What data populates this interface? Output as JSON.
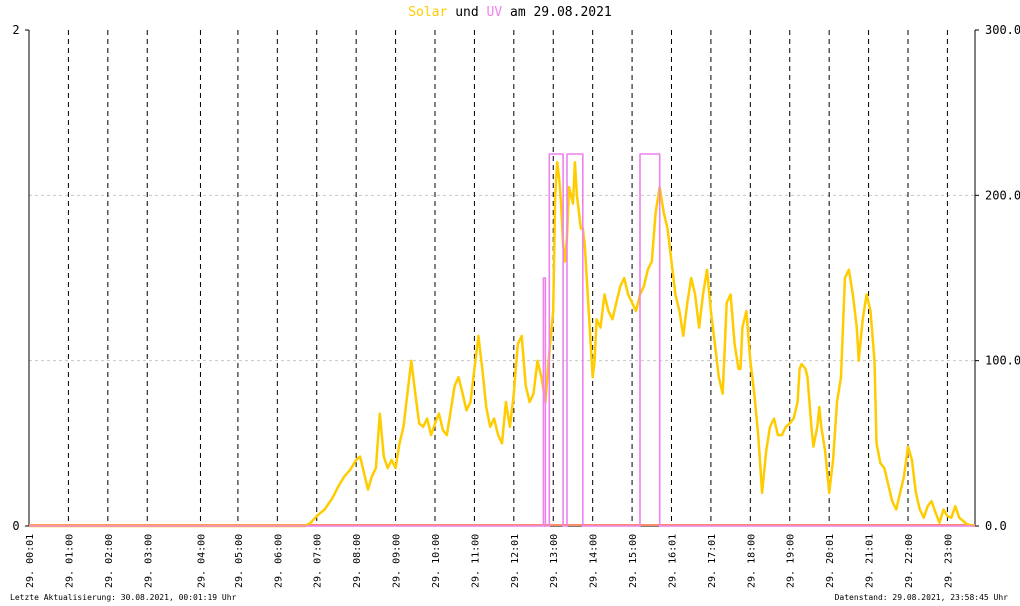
{
  "title": {
    "solar": "Solar",
    "und": "und",
    "uv": "UV",
    "rest": "am 29.08.2021"
  },
  "colors": {
    "solar": "#ffcc00",
    "uv": "#ee82ee",
    "axis": "#000000",
    "grid": "#000000",
    "hgrid": "#c8c8c8",
    "baseline": "#ff8c69"
  },
  "footer": {
    "left": "Letzte Aktualisierung: 30.08.2021, 00:01:19 Uhr",
    "right": "Datenstand: 29.08.2021, 23:58:45 Uhr"
  },
  "chart_data": {
    "type": "line",
    "x_unit": "hour of day",
    "xlim": [
      0,
      24
    ],
    "left_axis": {
      "ylim": [
        0,
        2
      ],
      "ticks": [
        0,
        2
      ],
      "tick_labels": [
        "0",
        "2"
      ]
    },
    "right_axis": {
      "ylim": [
        0,
        300
      ],
      "ticks": [
        0,
        100,
        200,
        300
      ],
      "tick_labels": [
        "0.0",
        "100.0",
        "200.0",
        "300.0"
      ]
    },
    "x_ticks": [
      {
        "x": 0.0,
        "label": "29. 00:01"
      },
      {
        "x": 1.0,
        "label": "29. 01:00"
      },
      {
        "x": 2.0,
        "label": "29. 02:00"
      },
      {
        "x": 3.0,
        "label": "29. 03:00"
      },
      {
        "x": 4.35,
        "label": "29. 04:00"
      },
      {
        "x": 5.3,
        "label": "29. 05:00"
      },
      {
        "x": 6.3,
        "label": "29. 06:00"
      },
      {
        "x": 7.3,
        "label": "29. 07:00"
      },
      {
        "x": 8.3,
        "label": "29. 08:00"
      },
      {
        "x": 9.3,
        "label": "29. 09:00"
      },
      {
        "x": 10.3,
        "label": "29. 10:00"
      },
      {
        "x": 11.3,
        "label": "29. 11:00"
      },
      {
        "x": 12.3,
        "label": "29. 12:01"
      },
      {
        "x": 13.3,
        "label": "29. 13:00"
      },
      {
        "x": 14.3,
        "label": "29. 14:00"
      },
      {
        "x": 15.3,
        "label": "29. 15:00"
      },
      {
        "x": 16.3,
        "label": "29. 16:01"
      },
      {
        "x": 17.3,
        "label": "29. 17:01"
      },
      {
        "x": 18.3,
        "label": "29. 18:00"
      },
      {
        "x": 19.3,
        "label": "29. 19:00"
      },
      {
        "x": 20.3,
        "label": "29. 20:01"
      },
      {
        "x": 21.3,
        "label": "29. 21:01"
      },
      {
        "x": 22.3,
        "label": "29. 22:00"
      },
      {
        "x": 23.3,
        "label": "29. 23:00"
      }
    ],
    "series": [
      {
        "name": "Solar",
        "axis": "right",
        "points": [
          [
            0,
            0
          ],
          [
            7.0,
            0
          ],
          [
            7.15,
            2
          ],
          [
            7.3,
            6
          ],
          [
            7.5,
            10
          ],
          [
            7.7,
            17
          ],
          [
            7.85,
            24
          ],
          [
            8.0,
            30
          ],
          [
            8.15,
            34
          ],
          [
            8.3,
            40
          ],
          [
            8.4,
            42
          ],
          [
            8.5,
            32
          ],
          [
            8.6,
            22
          ],
          [
            8.7,
            30
          ],
          [
            8.8,
            35
          ],
          [
            8.9,
            68
          ],
          [
            9.0,
            42
          ],
          [
            9.1,
            35
          ],
          [
            9.2,
            40
          ],
          [
            9.3,
            35
          ],
          [
            9.4,
            50
          ],
          [
            9.5,
            60
          ],
          [
            9.6,
            80
          ],
          [
            9.7,
            100
          ],
          [
            9.8,
            80
          ],
          [
            9.9,
            62
          ],
          [
            10.0,
            60
          ],
          [
            10.1,
            65
          ],
          [
            10.2,
            55
          ],
          [
            10.3,
            62
          ],
          [
            10.4,
            68
          ],
          [
            10.5,
            58
          ],
          [
            10.6,
            55
          ],
          [
            10.7,
            70
          ],
          [
            10.8,
            85
          ],
          [
            10.9,
            90
          ],
          [
            11.0,
            80
          ],
          [
            11.1,
            70
          ],
          [
            11.2,
            75
          ],
          [
            11.3,
            95
          ],
          [
            11.4,
            115
          ],
          [
            11.5,
            95
          ],
          [
            11.6,
            72
          ],
          [
            11.7,
            60
          ],
          [
            11.8,
            65
          ],
          [
            11.9,
            55
          ],
          [
            12.0,
            50
          ],
          [
            12.1,
            75
          ],
          [
            12.2,
            60
          ],
          [
            12.3,
            80
          ],
          [
            12.4,
            110
          ],
          [
            12.5,
            115
          ],
          [
            12.6,
            85
          ],
          [
            12.7,
            75
          ],
          [
            12.8,
            80
          ],
          [
            12.9,
            100
          ],
          [
            13.0,
            90
          ],
          [
            13.1,
            75
          ],
          [
            13.2,
            105
          ],
          [
            13.3,
            130
          ],
          [
            13.35,
            200
          ],
          [
            13.4,
            220
          ],
          [
            13.45,
            210
          ],
          [
            13.5,
            195
          ],
          [
            13.55,
            170
          ],
          [
            13.6,
            160
          ],
          [
            13.65,
            175
          ],
          [
            13.7,
            205
          ],
          [
            13.8,
            195
          ],
          [
            13.85,
            220
          ],
          [
            13.9,
            200
          ],
          [
            14.0,
            180
          ],
          [
            14.05,
            180
          ],
          [
            14.1,
            170
          ],
          [
            14.2,
            130
          ],
          [
            14.3,
            90
          ],
          [
            14.35,
            100
          ],
          [
            14.4,
            125
          ],
          [
            14.5,
            120
          ],
          [
            14.6,
            140
          ],
          [
            14.7,
            130
          ],
          [
            14.8,
            125
          ],
          [
            14.9,
            135
          ],
          [
            15.0,
            145
          ],
          [
            15.1,
            150
          ],
          [
            15.2,
            140
          ],
          [
            15.3,
            135
          ],
          [
            15.4,
            130
          ],
          [
            15.5,
            140
          ],
          [
            15.6,
            145
          ],
          [
            15.7,
            155
          ],
          [
            15.8,
            160
          ],
          [
            15.9,
            190
          ],
          [
            16.0,
            205
          ],
          [
            16.1,
            190
          ],
          [
            16.2,
            180
          ],
          [
            16.3,
            160
          ],
          [
            16.4,
            140
          ],
          [
            16.5,
            130
          ],
          [
            16.6,
            115
          ],
          [
            16.7,
            135
          ],
          [
            16.8,
            150
          ],
          [
            16.9,
            140
          ],
          [
            17.0,
            120
          ],
          [
            17.1,
            140
          ],
          [
            17.2,
            155
          ],
          [
            17.3,
            130
          ],
          [
            17.4,
            110
          ],
          [
            17.5,
            90
          ],
          [
            17.6,
            80
          ],
          [
            17.7,
            135
          ],
          [
            17.8,
            140
          ],
          [
            17.9,
            110
          ],
          [
            18.0,
            95
          ],
          [
            18.05,
            95
          ],
          [
            18.1,
            120
          ],
          [
            18.2,
            130
          ],
          [
            18.3,
            100
          ],
          [
            18.4,
            80
          ],
          [
            18.5,
            55
          ],
          [
            18.6,
            20
          ],
          [
            18.7,
            45
          ],
          [
            18.8,
            60
          ],
          [
            18.9,
            65
          ],
          [
            19.0,
            55
          ],
          [
            19.1,
            55
          ],
          [
            19.2,
            60
          ],
          [
            19.3,
            62
          ],
          [
            19.4,
            65
          ],
          [
            19.5,
            75
          ],
          [
            19.55,
            95
          ],
          [
            19.6,
            98
          ],
          [
            19.7,
            95
          ],
          [
            19.75,
            90
          ],
          [
            19.85,
            60
          ],
          [
            19.9,
            48
          ],
          [
            20.0,
            60
          ],
          [
            20.05,
            72
          ],
          [
            20.1,
            60
          ],
          [
            20.2,
            45
          ],
          [
            20.3,
            20
          ],
          [
            20.4,
            40
          ],
          [
            20.5,
            75
          ],
          [
            20.6,
            90
          ],
          [
            20.7,
            150
          ],
          [
            20.8,
            155
          ],
          [
            20.9,
            140
          ],
          [
            21.0,
            120
          ],
          [
            21.05,
            100
          ],
          [
            21.15,
            125
          ],
          [
            21.25,
            140
          ],
          [
            21.35,
            130
          ],
          [
            21.45,
            100
          ],
          [
            21.5,
            50
          ],
          [
            21.6,
            38
          ],
          [
            21.7,
            35
          ],
          [
            21.8,
            25
          ],
          [
            21.9,
            15
          ],
          [
            22.0,
            10
          ],
          [
            22.1,
            20
          ],
          [
            22.2,
            30
          ],
          [
            22.3,
            48
          ],
          [
            22.4,
            40
          ],
          [
            22.5,
            20
          ],
          [
            22.6,
            10
          ],
          [
            22.7,
            5
          ],
          [
            22.8,
            12
          ],
          [
            22.9,
            15
          ],
          [
            23.0,
            8
          ],
          [
            23.1,
            2
          ],
          [
            23.2,
            10
          ],
          [
            23.3,
            6
          ],
          [
            23.4,
            5
          ],
          [
            23.5,
            12
          ],
          [
            23.6,
            5
          ],
          [
            23.7,
            3
          ],
          [
            23.8,
            1
          ],
          [
            24,
            0
          ]
        ]
      },
      {
        "name": "UV",
        "axis": "left",
        "points": [
          [
            0,
            0
          ],
          [
            13.05,
            0
          ],
          [
            13.05,
            1
          ],
          [
            13.1,
            1
          ],
          [
            13.1,
            0
          ],
          [
            13.2,
            0
          ],
          [
            13.2,
            1.5
          ],
          [
            13.55,
            1.5
          ],
          [
            13.55,
            0
          ],
          [
            13.65,
            0
          ],
          [
            13.65,
            1.5
          ],
          [
            14.05,
            1.5
          ],
          [
            14.05,
            0
          ],
          [
            15.5,
            0
          ],
          [
            15.5,
            1.5
          ],
          [
            16.0,
            1.5
          ],
          [
            16.0,
            0
          ],
          [
            24,
            0
          ]
        ]
      }
    ]
  }
}
